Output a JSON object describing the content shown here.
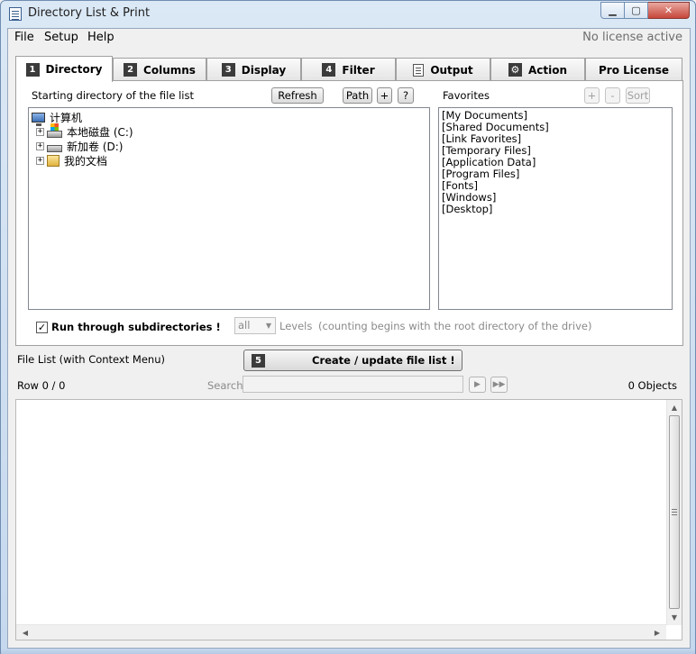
{
  "window": {
    "title": "Directory List & Print"
  },
  "menu": {
    "items": [
      "File",
      "Setup",
      "Help"
    ],
    "license_status": "No license active"
  },
  "tabs": [
    {
      "num": "1",
      "label": "Directory"
    },
    {
      "num": "2",
      "label": "Columns"
    },
    {
      "num": "3",
      "label": "Display"
    },
    {
      "num": "4",
      "label": "Filter"
    },
    {
      "num": "",
      "label": "Output",
      "icon": "document-icon"
    },
    {
      "num": "",
      "label": "Action",
      "icon": "gear-icon"
    },
    {
      "num": "",
      "label": "Pro License"
    }
  ],
  "directory": {
    "start_label": "Starting directory of the file list",
    "refresh_label": "Refresh",
    "path_label": "Path",
    "plus_label": "+",
    "help_label": "?",
    "tree": [
      {
        "label": "计算机",
        "icon": "computer-icon"
      },
      {
        "label": "本地磁盘 (C:)",
        "icon": "drive-c-icon"
      },
      {
        "label": "新加卷 (D:)",
        "icon": "drive-d-icon"
      },
      {
        "label": "我的文档",
        "icon": "documents-folder-icon"
      }
    ],
    "favorites_label": "Favorites",
    "fav_add": "+",
    "fav_remove": "-",
    "fav_sort": "Sort",
    "favorites": [
      "[My Documents]",
      "[Shared Documents]",
      "[Link Favorites]",
      "[Temporary Files]",
      "[Application Data]",
      "[Program Files]",
      "[Fonts]",
      "[Windows]",
      "[Desktop]"
    ],
    "subdirs_label": "Run through subdirectories !",
    "subdirs_checked": true,
    "levels_value": "all",
    "levels_label": "Levels",
    "levels_note": "(counting begins with the root directory of the drive)"
  },
  "filelist": {
    "title": "File List (with Context Menu)",
    "create_num": "5",
    "create_label": "Create / update file list !",
    "row_status": "Row 0 / 0",
    "search_label": "Search",
    "search_value": "",
    "objects_count": "0 Objects"
  }
}
